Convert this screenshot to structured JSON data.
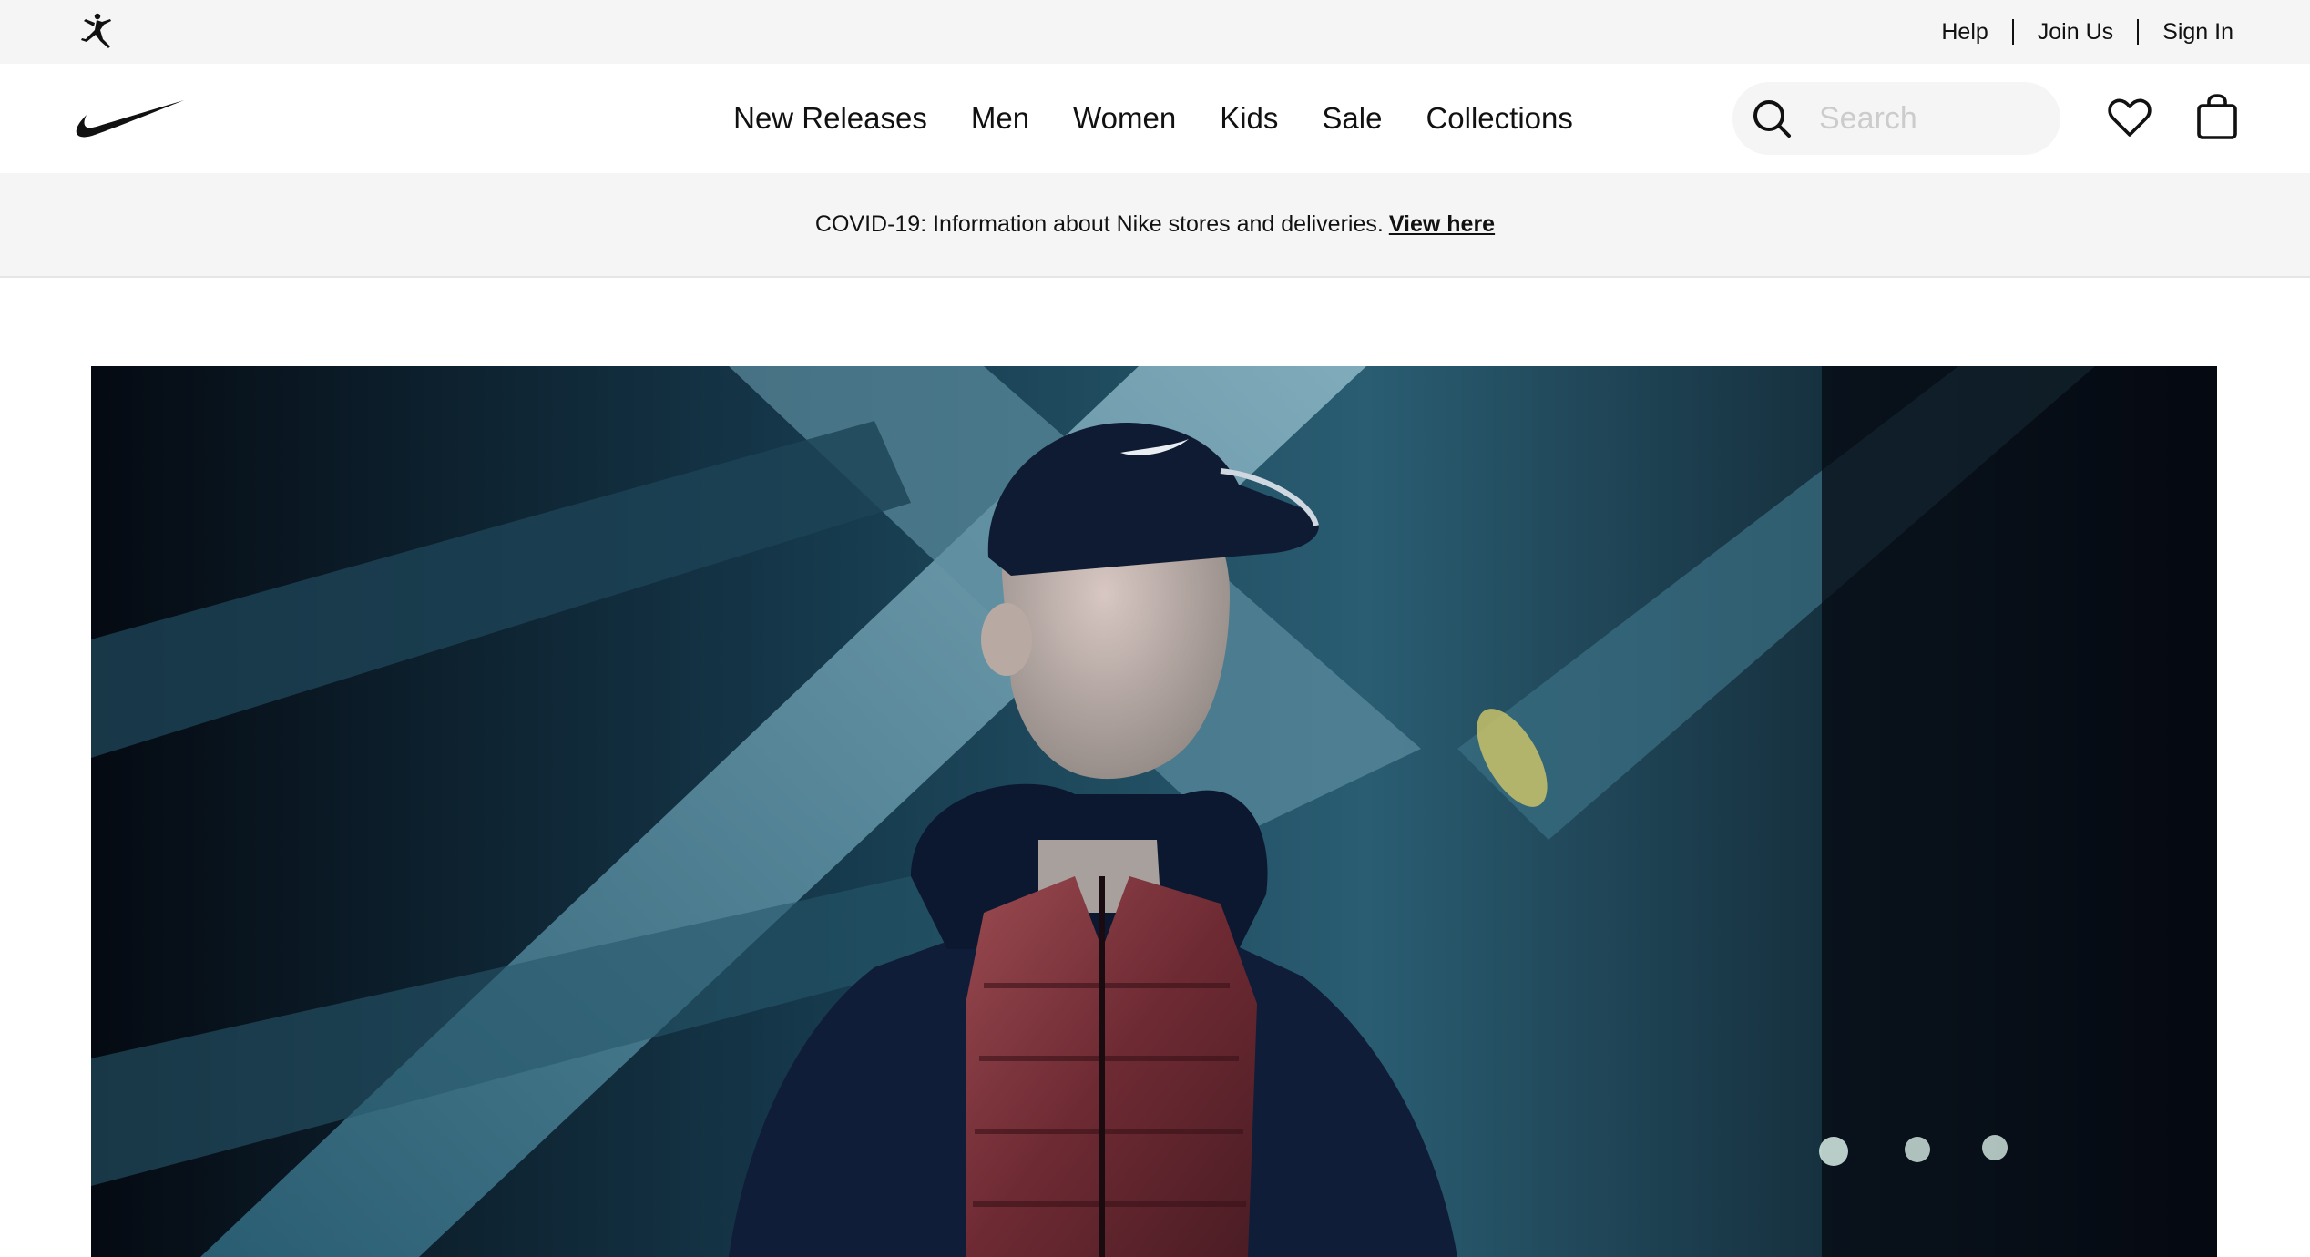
{
  "utility_bar": {
    "logo_icon": "jordan-jumpman-icon",
    "links": [
      "Help",
      "Join Us",
      "Sign In"
    ]
  },
  "nav": {
    "logo_icon": "nike-swoosh-icon",
    "menu": [
      "New Releases",
      "Men",
      "Women",
      "Kids",
      "Sale",
      "Collections"
    ],
    "search": {
      "placeholder": "Search",
      "icon": "search-icon"
    },
    "favorites_icon": "heart-icon",
    "bag_icon": "shopping-bag-icon"
  },
  "banner": {
    "text": "COVID-19: Information about Nike stores and deliveries.",
    "link": "View here"
  },
  "colors": {
    "utility_bg": "#f5f5f5",
    "text": "#111111",
    "hero_dark": "#07101c",
    "hero_teal": "#2e6478",
    "vest": "#7a3038"
  }
}
